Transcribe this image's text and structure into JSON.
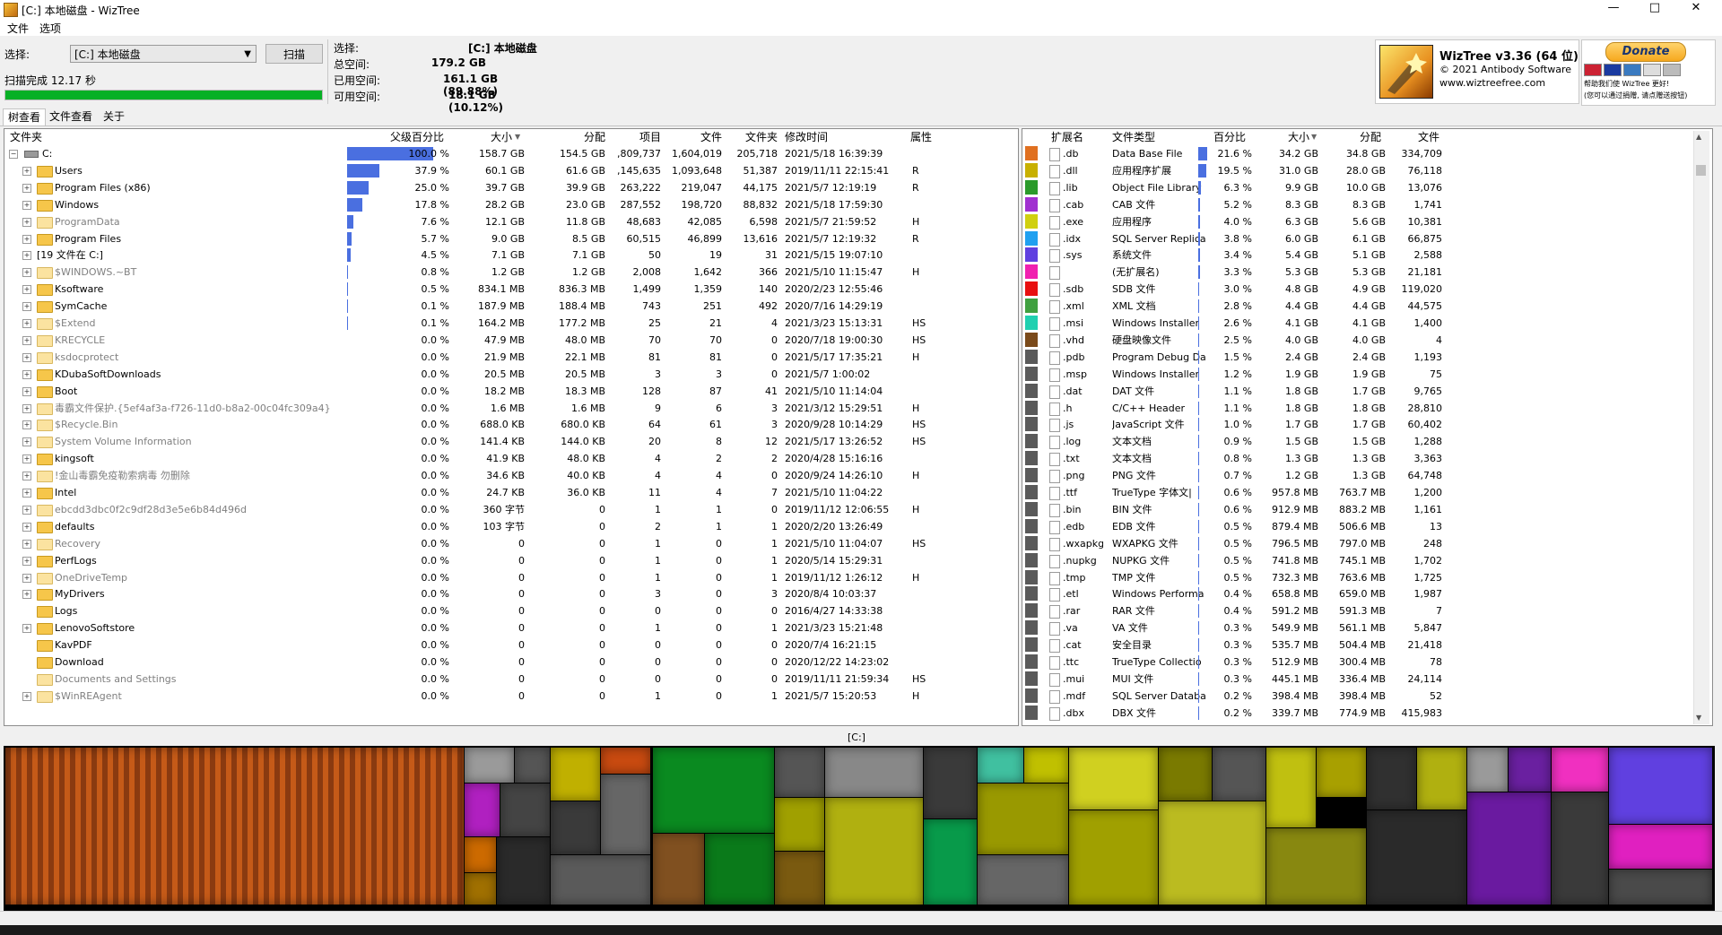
{
  "window": {
    "title": "[C:] 本地磁盘  - WizTree",
    "min": "—",
    "max": "□",
    "close": "✕"
  },
  "menu": [
    "文件",
    "选项"
  ],
  "scan": {
    "select_label": "选择:",
    "drive_value": "[C:] 本地磁盘",
    "scan_button": "扫描",
    "status": "扫描完成 12.17 秒",
    "progress": 1.0
  },
  "info": {
    "select_label": "选择:",
    "select_value": "[C:]  本地磁盘",
    "total_label": "总空间:",
    "total_value": "179.2 GB",
    "used_label": "已用空间:",
    "used_value": "161.1 GB  (89.88%)",
    "free_label": "可用空间:",
    "free_value": "18.1 GB  (10.12%)"
  },
  "about": {
    "title": "WizTree v3.36 (64 位)",
    "copyright": "© 2021 Antibody Software",
    "url": "www.wiztreefree.com",
    "donate": "Donate",
    "donate_note1": "帮助我们使 WizTree 更好!",
    "donate_note2": "(您可以通过捐赠, 请点赠送按钮)"
  },
  "tabs": [
    "树查看",
    "文件查看",
    "关于"
  ],
  "tree": {
    "headers": {
      "folder": "文件夹",
      "parent_pct": "父级百分比",
      "size": "大小",
      "alloc": "分配",
      "items": "项目",
      "files": "文件",
      "folders": "文件夹",
      "modified": "修改时间",
      "attr": "属性"
    },
    "sort_arrow": "▼",
    "rows": [
      {
        "name": "C:",
        "pct": "100.0 %",
        "pv": 100.0,
        "size": "158.7 GB",
        "alloc": "154.5 GB",
        "items": ",809,737",
        "files": "1,604,019",
        "folders": "205,718",
        "mod": "2021/5/18 16:39:39",
        "attr": "",
        "root": true
      },
      {
        "name": "Users",
        "pct": "37.9 %",
        "pv": 37.9,
        "size": "60.1 GB",
        "alloc": "61.6 GB",
        "items": ",145,635",
        "files": "1,093,648",
        "folders": "51,387",
        "mod": "2019/11/11 22:15:41",
        "attr": "R"
      },
      {
        "name": "Program Files (x86)",
        "pct": "25.0 %",
        "pv": 25.0,
        "size": "39.7 GB",
        "alloc": "39.9 GB",
        "items": "263,222",
        "files": "219,047",
        "folders": "44,175",
        "mod": "2021/5/7 12:19:19",
        "attr": "R"
      },
      {
        "name": "Windows",
        "pct": "17.8 %",
        "pv": 17.8,
        "size": "28.2 GB",
        "alloc": "23.0 GB",
        "items": "287,552",
        "files": "198,720",
        "folders": "88,832",
        "mod": "2021/5/18 17:59:30",
        "attr": ""
      },
      {
        "name": "ProgramData",
        "pct": "7.6 %",
        "pv": 7.6,
        "size": "12.1 GB",
        "alloc": "11.8 GB",
        "items": "48,683",
        "files": "42,085",
        "folders": "6,598",
        "mod": "2021/5/7 21:59:52",
        "attr": "H",
        "sys": true
      },
      {
        "name": "Program Files",
        "pct": "5.7 %",
        "pv": 5.7,
        "size": "9.0 GB",
        "alloc": "8.5 GB",
        "items": "60,515",
        "files": "46,899",
        "folders": "13,616",
        "mod": "2021/5/7 12:19:32",
        "attr": "R"
      },
      {
        "name": "[19 文件在 C:]",
        "pct": "4.5 %",
        "pv": 4.5,
        "size": "7.1 GB",
        "alloc": "7.1 GB",
        "items": "50",
        "files": "19",
        "folders": "31",
        "mod": "2021/5/15 19:07:10",
        "attr": "",
        "nofolder": true
      },
      {
        "name": "$WINDOWS.~BT",
        "pct": "0.8 %",
        "pv": 0.8,
        "size": "1.2 GB",
        "alloc": "1.2 GB",
        "items": "2,008",
        "files": "1,642",
        "folders": "366",
        "mod": "2021/5/10 11:15:47",
        "attr": "H",
        "sys": true
      },
      {
        "name": "Ksoftware",
        "pct": "0.5 %",
        "pv": 0.5,
        "size": "834.1 MB",
        "alloc": "836.3 MB",
        "items": "1,499",
        "files": "1,359",
        "folders": "140",
        "mod": "2020/2/23 12:55:46",
        "attr": ""
      },
      {
        "name": "SymCache",
        "pct": "0.1 %",
        "pv": 0.1,
        "size": "187.9 MB",
        "alloc": "188.4 MB",
        "items": "743",
        "files": "251",
        "folders": "492",
        "mod": "2020/7/16 14:29:19",
        "attr": ""
      },
      {
        "name": "$Extend",
        "pct": "0.1 %",
        "pv": 0.1,
        "size": "164.2 MB",
        "alloc": "177.2 MB",
        "items": "25",
        "files": "21",
        "folders": "4",
        "mod": "2021/3/23 15:13:31",
        "attr": "HS",
        "sys": true
      },
      {
        "name": "KRECYCLE",
        "pct": "0.0 %",
        "pv": 0.0,
        "size": "47.9 MB",
        "alloc": "48.0 MB",
        "items": "70",
        "files": "70",
        "folders": "0",
        "mod": "2020/7/18 19:00:30",
        "attr": "HS",
        "sys": true
      },
      {
        "name": "ksdocprotect",
        "pct": "0.0 %",
        "pv": 0.0,
        "size": "21.9 MB",
        "alloc": "22.1 MB",
        "items": "81",
        "files": "81",
        "folders": "0",
        "mod": "2021/5/17 17:35:21",
        "attr": "H",
        "sys": true
      },
      {
        "name": "KDubaSoftDownloads",
        "pct": "0.0 %",
        "pv": 0.0,
        "size": "20.5 MB",
        "alloc": "20.5 MB",
        "items": "3",
        "files": "3",
        "folders": "0",
        "mod": "2021/5/7 1:00:02",
        "attr": ""
      },
      {
        "name": "Boot",
        "pct": "0.0 %",
        "pv": 0.0,
        "size": "18.2 MB",
        "alloc": "18.3 MB",
        "items": "128",
        "files": "87",
        "folders": "41",
        "mod": "2021/5/10 11:14:04",
        "attr": ""
      },
      {
        "name": "毒霸文件保护.{5ef4af3a-f726-11d0-b8a2-00c04fc309a4}",
        "pct": "0.0 %",
        "pv": 0.0,
        "size": "1.6 MB",
        "alloc": "1.6 MB",
        "items": "9",
        "files": "6",
        "folders": "3",
        "mod": "2021/3/12 15:29:51",
        "attr": "H",
        "sys": true
      },
      {
        "name": "$Recycle.Bin",
        "pct": "0.0 %",
        "pv": 0.0,
        "size": "688.0 KB",
        "alloc": "680.0 KB",
        "items": "64",
        "files": "61",
        "folders": "3",
        "mod": "2020/9/28 10:14:29",
        "attr": "HS",
        "sys": true
      },
      {
        "name": "System Volume Information",
        "pct": "0.0 %",
        "pv": 0.0,
        "size": "141.4 KB",
        "alloc": "144.0 KB",
        "items": "20",
        "files": "8",
        "folders": "12",
        "mod": "2021/5/17 13:26:52",
        "attr": "HS",
        "sys": true
      },
      {
        "name": "kingsoft",
        "pct": "0.0 %",
        "pv": 0.0,
        "size": "41.9 KB",
        "alloc": "48.0 KB",
        "items": "4",
        "files": "2",
        "folders": "2",
        "mod": "2020/4/28 15:16:16",
        "attr": ""
      },
      {
        "name": "!金山毒霸免疫勒索病毒 勿删除",
        "pct": "0.0 %",
        "pv": 0.0,
        "size": "34.6 KB",
        "alloc": "40.0 KB",
        "items": "4",
        "files": "4",
        "folders": "0",
        "mod": "2020/9/24 14:26:10",
        "attr": "H",
        "sys": true
      },
      {
        "name": "Intel",
        "pct": "0.0 %",
        "pv": 0.0,
        "size": "24.7 KB",
        "alloc": "36.0 KB",
        "items": "11",
        "files": "4",
        "folders": "7",
        "mod": "2021/5/10 11:04:22",
        "attr": ""
      },
      {
        "name": "ebcdd3dbc0f2c9df28d3e5e6b84d496d",
        "pct": "0.0 %",
        "pv": 0.0,
        "size": "360 字节",
        "alloc": "0",
        "items": "1",
        "files": "1",
        "folders": "0",
        "mod": "2019/11/12 12:06:55",
        "attr": "H",
        "sys": true
      },
      {
        "name": "defaults",
        "pct": "0.0 %",
        "pv": 0.0,
        "size": "103 字节",
        "alloc": "0",
        "items": "2",
        "files": "1",
        "folders": "1",
        "mod": "2020/2/20 13:26:49",
        "attr": ""
      },
      {
        "name": "Recovery",
        "pct": "0.0 %",
        "pv": 0.0,
        "size": "0",
        "alloc": "0",
        "items": "1",
        "files": "0",
        "folders": "1",
        "mod": "2021/5/10 11:04:07",
        "attr": "HS",
        "sys": true
      },
      {
        "name": "PerfLogs",
        "pct": "0.0 %",
        "pv": 0.0,
        "size": "0",
        "alloc": "0",
        "items": "1",
        "files": "0",
        "folders": "1",
        "mod": "2020/5/14 15:29:31",
        "attr": ""
      },
      {
        "name": "OneDriveTemp",
        "pct": "0.0 %",
        "pv": 0.0,
        "size": "0",
        "alloc": "0",
        "items": "1",
        "files": "0",
        "folders": "1",
        "mod": "2019/11/12 1:26:12",
        "attr": "H",
        "sys": true
      },
      {
        "name": "MyDrivers",
        "pct": "0.0 %",
        "pv": 0.0,
        "size": "0",
        "alloc": "0",
        "items": "3",
        "files": "0",
        "folders": "3",
        "mod": "2020/8/4 10:03:37",
        "attr": ""
      },
      {
        "name": "Logs",
        "pct": "0.0 %",
        "pv": 0.0,
        "size": "0",
        "alloc": "0",
        "items": "0",
        "files": "0",
        "folders": "0",
        "mod": "2016/4/27 14:33:38",
        "attr": "",
        "noexp": true
      },
      {
        "name": "LenovoSoftstore",
        "pct": "0.0 %",
        "pv": 0.0,
        "size": "0",
        "alloc": "0",
        "items": "1",
        "files": "0",
        "folders": "1",
        "mod": "2021/3/23 15:21:48",
        "attr": ""
      },
      {
        "name": "KavPDF",
        "pct": "0.0 %",
        "pv": 0.0,
        "size": "0",
        "alloc": "0",
        "items": "0",
        "files": "0",
        "folders": "0",
        "mod": "2020/7/4 16:21:15",
        "attr": "",
        "noexp": true
      },
      {
        "name": "Download",
        "pct": "0.0 %",
        "pv": 0.0,
        "size": "0",
        "alloc": "0",
        "items": "0",
        "files": "0",
        "folders": "0",
        "mod": "2020/12/22 14:23:02",
        "attr": "",
        "noexp": true
      },
      {
        "name": "Documents and Settings",
        "pct": "0.0 %",
        "pv": 0.0,
        "size": "0",
        "alloc": "0",
        "items": "0",
        "files": "0",
        "folders": "0",
        "mod": "2019/11/11 21:59:34",
        "attr": "HS",
        "sys": true,
        "noexp": true
      },
      {
        "name": "$WinREAgent",
        "pct": "0.0 %",
        "pv": 0.0,
        "size": "0",
        "alloc": "0",
        "items": "1",
        "files": "0",
        "folders": "1",
        "mod": "2021/5/7 15:20:53",
        "attr": "H",
        "sys": true
      }
    ]
  },
  "ext": {
    "headers": {
      "ext": "扩展名",
      "type": "文件类型",
      "pct": "百分比",
      "size": "大小",
      "alloc": "分配",
      "files": "文件"
    },
    "sort_arrow": "▼",
    "rows": [
      {
        "color": "#e07020",
        "ext": ".db",
        "type": "Data Base File",
        "pct": "21.6 %",
        "pv": 21.6,
        "size": "34.2 GB",
        "alloc": "34.8 GB",
        "files": "334,709"
      },
      {
        "color": "#c8b000",
        "ext": ".dll",
        "type": "应用程序扩展",
        "pct": "19.5 %",
        "pv": 19.5,
        "size": "31.0 GB",
        "alloc": "28.0 GB",
        "files": "76,118"
      },
      {
        "color": "#2a9a2a",
        "ext": ".lib",
        "type": "Object File Library",
        "pct": "6.3 %",
        "pv": 6.3,
        "size": "9.9 GB",
        "alloc": "10.0 GB",
        "files": "13,076"
      },
      {
        "color": "#a030d0",
        "ext": ".cab",
        "type": "CAB 文件",
        "pct": "5.2 %",
        "pv": 5.2,
        "size": "8.3 GB",
        "alloc": "8.3 GB",
        "files": "1,741"
      },
      {
        "color": "#d0d010",
        "ext": ".exe",
        "type": "应用程序",
        "pct": "4.0 %",
        "pv": 4.0,
        "size": "6.3 GB",
        "alloc": "5.6 GB",
        "files": "10,381"
      },
      {
        "color": "#20a0f0",
        "ext": ".idx",
        "type": "SQL Server Replica",
        "pct": "3.8 %",
        "pv": 3.8,
        "size": "6.0 GB",
        "alloc": "6.1 GB",
        "files": "66,875"
      },
      {
        "color": "#6040e0",
        "ext": ".sys",
        "type": "系统文件",
        "pct": "3.4 %",
        "pv": 3.4,
        "size": "5.4 GB",
        "alloc": "5.1 GB",
        "files": "2,588"
      },
      {
        "color": "#f020b0",
        "ext": "",
        "type": "(无扩展名)",
        "pct": "3.3 %",
        "pv": 3.3,
        "size": "5.3 GB",
        "alloc": "5.3 GB",
        "files": "21,181"
      },
      {
        "color": "#e81010",
        "ext": ".sdb",
        "type": "SDB 文件",
        "pct": "3.0 %",
        "pv": 3.0,
        "size": "4.8 GB",
        "alloc": "4.9 GB",
        "files": "119,020"
      },
      {
        "color": "#40a040",
        "ext": ".xml",
        "type": "XML 文档",
        "pct": "2.8 %",
        "pv": 2.8,
        "size": "4.4 GB",
        "alloc": "4.4 GB",
        "files": "44,575"
      },
      {
        "color": "#20d0b0",
        "ext": ".msi",
        "type": "Windows Installer",
        "pct": "2.6 %",
        "pv": 2.6,
        "size": "4.1 GB",
        "alloc": "4.1 GB",
        "files": "1,400"
      },
      {
        "color": "#7a4a1a",
        "ext": ".vhd",
        "type": "硬盘映像文件",
        "pct": "2.5 %",
        "pv": 2.5,
        "size": "4.0 GB",
        "alloc": "4.0 GB",
        "files": "4"
      },
      {
        "color": "#5a5a5a",
        "ext": ".pdb",
        "type": "Program Debug Da",
        "pct": "1.5 %",
        "pv": 1.5,
        "size": "2.4 GB",
        "alloc": "2.4 GB",
        "files": "1,193"
      },
      {
        "color": "#5a5a5a",
        "ext": ".msp",
        "type": "Windows Installer",
        "pct": "1.2 %",
        "pv": 1.2,
        "size": "1.9 GB",
        "alloc": "1.9 GB",
        "files": "75"
      },
      {
        "color": "#5a5a5a",
        "ext": ".dat",
        "type": "DAT 文件",
        "pct": "1.1 %",
        "pv": 1.1,
        "size": "1.8 GB",
        "alloc": "1.7 GB",
        "files": "9,765"
      },
      {
        "color": "#5a5a5a",
        "ext": ".h",
        "type": "C/C++ Header",
        "pct": "1.1 %",
        "pv": 1.1,
        "size": "1.8 GB",
        "alloc": "1.8 GB",
        "files": "28,810"
      },
      {
        "color": "#5a5a5a",
        "ext": ".js",
        "type": "JavaScript 文件",
        "pct": "1.0 %",
        "pv": 1.0,
        "size": "1.7 GB",
        "alloc": "1.7 GB",
        "files": "60,402"
      },
      {
        "color": "#5a5a5a",
        "ext": ".log",
        "type": "文本文档",
        "pct": "0.9 %",
        "pv": 0.9,
        "size": "1.5 GB",
        "alloc": "1.5 GB",
        "files": "1,288"
      },
      {
        "color": "#5a5a5a",
        "ext": ".txt",
        "type": "文本文档",
        "pct": "0.8 %",
        "pv": 0.8,
        "size": "1.3 GB",
        "alloc": "1.3 GB",
        "files": "3,363"
      },
      {
        "color": "#5a5a5a",
        "ext": ".png",
        "type": "PNG 文件",
        "pct": "0.7 %",
        "pv": 0.7,
        "size": "1.2 GB",
        "alloc": "1.3 GB",
        "files": "64,748"
      },
      {
        "color": "#5a5a5a",
        "ext": ".ttf",
        "type": "TrueType 字体文|",
        "pct": "0.6 %",
        "pv": 0.6,
        "size": "957.8 MB",
        "alloc": "763.7 MB",
        "files": "1,200"
      },
      {
        "color": "#5a5a5a",
        "ext": ".bin",
        "type": "BIN 文件",
        "pct": "0.6 %",
        "pv": 0.6,
        "size": "912.9 MB",
        "alloc": "883.2 MB",
        "files": "1,161"
      },
      {
        "color": "#5a5a5a",
        "ext": ".edb",
        "type": "EDB 文件",
        "pct": "0.5 %",
        "pv": 0.5,
        "size": "879.4 MB",
        "alloc": "506.6 MB",
        "files": "13"
      },
      {
        "color": "#5a5a5a",
        "ext": ".wxapkg",
        "type": "WXAPKG 文件",
        "pct": "0.5 %",
        "pv": 0.5,
        "size": "796.5 MB",
        "alloc": "797.0 MB",
        "files": "248"
      },
      {
        "color": "#5a5a5a",
        "ext": ".nupkg",
        "type": "NUPKG 文件",
        "pct": "0.5 %",
        "pv": 0.5,
        "size": "741.8 MB",
        "alloc": "745.1 MB",
        "files": "1,702"
      },
      {
        "color": "#5a5a5a",
        "ext": ".tmp",
        "type": "TMP 文件",
        "pct": "0.5 %",
        "pv": 0.5,
        "size": "732.3 MB",
        "alloc": "763.6 MB",
        "files": "1,725"
      },
      {
        "color": "#5a5a5a",
        "ext": ".etl",
        "type": "Windows Performa",
        "pct": "0.4 %",
        "pv": 0.4,
        "size": "658.8 MB",
        "alloc": "659.0 MB",
        "files": "1,987"
      },
      {
        "color": "#5a5a5a",
        "ext": ".rar",
        "type": "RAR 文件",
        "pct": "0.4 %",
        "pv": 0.4,
        "size": "591.2 MB",
        "alloc": "591.3 MB",
        "files": "7"
      },
      {
        "color": "#5a5a5a",
        "ext": ".va",
        "type": "VA 文件",
        "pct": "0.3 %",
        "pv": 0.3,
        "size": "549.9 MB",
        "alloc": "561.1 MB",
        "files": "5,847"
      },
      {
        "color": "#5a5a5a",
        "ext": ".cat",
        "type": "安全目录",
        "pct": "0.3 %",
        "pv": 0.3,
        "size": "535.7 MB",
        "alloc": "504.4 MB",
        "files": "21,418"
      },
      {
        "color": "#5a5a5a",
        "ext": ".ttc",
        "type": "TrueType Collectio",
        "pct": "0.3 %",
        "pv": 0.3,
        "size": "512.9 MB",
        "alloc": "300.4 MB",
        "files": "78"
      },
      {
        "color": "#5a5a5a",
        "ext": ".mui",
        "type": "MUI 文件",
        "pct": "0.3 %",
        "pv": 0.3,
        "size": "445.1 MB",
        "alloc": "336.4 MB",
        "files": "24,114"
      },
      {
        "color": "#5a5a5a",
        "ext": ".mdf",
        "type": "SQL Server Databa",
        "pct": "0.2 %",
        "pv": 0.2,
        "size": "398.4 MB",
        "alloc": "398.4 MB",
        "files": "52"
      },
      {
        "color": "#5a5a5a",
        "ext": ".dbx",
        "type": "DBX 文件",
        "pct": "0.2 %",
        "pv": 0.2,
        "size": "339.7 MB",
        "alloc": "774.9 MB",
        "files": "415,983"
      }
    ]
  },
  "treemap": {
    "label": "[C:]"
  },
  "colors": {
    "bar": "#4a6fe0",
    "progress": "#06b025"
  }
}
